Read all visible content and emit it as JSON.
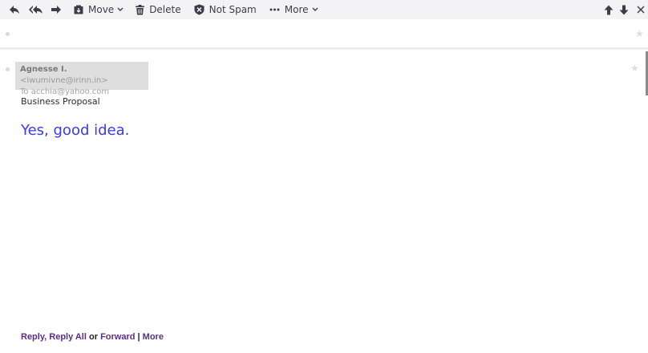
{
  "toolbar": {
    "move_label": "Move",
    "delete_label": "Delete",
    "not_spam_label": "Not Spam",
    "more_label": "More"
  },
  "message": {
    "from_name": "Agnesse I.",
    "from_email": "<iwumivne@irinn.in>",
    "to_line": "To acchia@yahoo.com",
    "subject": "Business Proposal",
    "body": "Yes, good idea."
  },
  "footer": {
    "reply": "Reply",
    "sep1": ",",
    "reply_all": "Reply All",
    "or": "or",
    "forward": "Forward",
    "pipe": "|",
    "more": "More"
  },
  "colors": {
    "toolbar_bg": "#f3f3f5",
    "body_text": "#3a3be8",
    "link": "#5b2c83"
  },
  "icons": [
    "reply-icon",
    "reply-all-icon",
    "forward-icon",
    "move-icon",
    "delete-icon",
    "not-spam-icon",
    "more-dots-icon",
    "prev-message-icon",
    "next-message-icon",
    "close-icon",
    "star-icon"
  ]
}
